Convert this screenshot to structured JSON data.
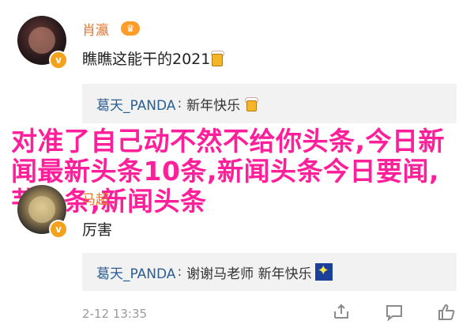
{
  "comment1": {
    "username": "肖瀛",
    "text": "瞧瞧这能干的2021",
    "reply": {
      "user": "葛天_PANDA",
      "separator": ":",
      "text": "新年快乐"
    }
  },
  "overlay": {
    "title": "对准了自己动不然不给你头条,今日新闻最新头条10条,新闻头条今日要闻,芋头条,新闻头条"
  },
  "comment2": {
    "username": "马超",
    "text": "厉害",
    "reply": {
      "user": "葛天_PANDA",
      "separator": ":",
      "text": "谢谢马老师 新年快乐"
    },
    "time": "2-12 13:35"
  },
  "colors": {
    "username": "#e3772d",
    "reply_user": "#2a5f94",
    "overlay": "#ff1f9a"
  },
  "icons": [
    "verified-badge-icon",
    "level-badge-icon",
    "beer-emoji-icon",
    "sparkle-emoji-icon",
    "share-icon",
    "comment-icon",
    "like-icon"
  ]
}
